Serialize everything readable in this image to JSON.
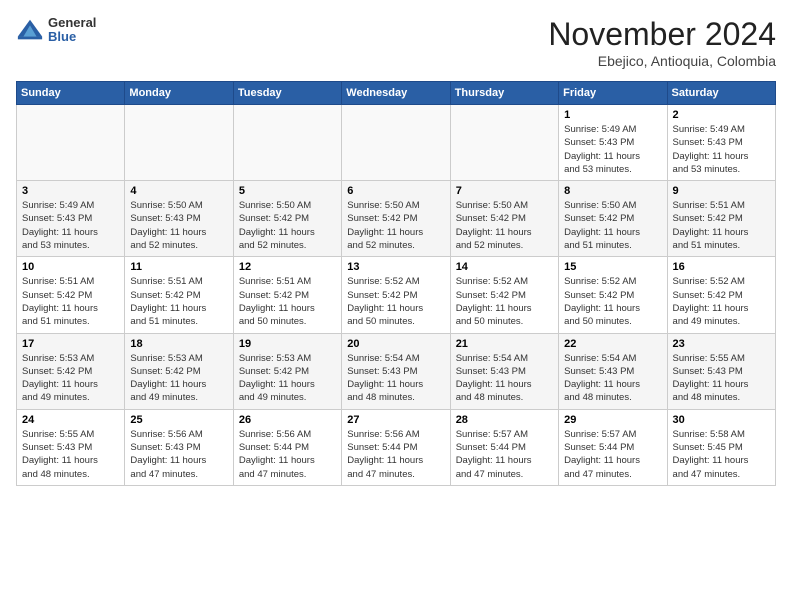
{
  "logo": {
    "text_general": "General",
    "text_blue": "Blue"
  },
  "header": {
    "month": "November 2024",
    "location": "Ebejico, Antioquia, Colombia"
  },
  "days_of_week": [
    "Sunday",
    "Monday",
    "Tuesday",
    "Wednesday",
    "Thursday",
    "Friday",
    "Saturday"
  ],
  "weeks": [
    [
      {
        "day": "",
        "info": ""
      },
      {
        "day": "",
        "info": ""
      },
      {
        "day": "",
        "info": ""
      },
      {
        "day": "",
        "info": ""
      },
      {
        "day": "",
        "info": ""
      },
      {
        "day": "1",
        "info": "Sunrise: 5:49 AM\nSunset: 5:43 PM\nDaylight: 11 hours\nand 53 minutes."
      },
      {
        "day": "2",
        "info": "Sunrise: 5:49 AM\nSunset: 5:43 PM\nDaylight: 11 hours\nand 53 minutes."
      }
    ],
    [
      {
        "day": "3",
        "info": "Sunrise: 5:49 AM\nSunset: 5:43 PM\nDaylight: 11 hours\nand 53 minutes."
      },
      {
        "day": "4",
        "info": "Sunrise: 5:50 AM\nSunset: 5:43 PM\nDaylight: 11 hours\nand 52 minutes."
      },
      {
        "day": "5",
        "info": "Sunrise: 5:50 AM\nSunset: 5:42 PM\nDaylight: 11 hours\nand 52 minutes."
      },
      {
        "day": "6",
        "info": "Sunrise: 5:50 AM\nSunset: 5:42 PM\nDaylight: 11 hours\nand 52 minutes."
      },
      {
        "day": "7",
        "info": "Sunrise: 5:50 AM\nSunset: 5:42 PM\nDaylight: 11 hours\nand 52 minutes."
      },
      {
        "day": "8",
        "info": "Sunrise: 5:50 AM\nSunset: 5:42 PM\nDaylight: 11 hours\nand 51 minutes."
      },
      {
        "day": "9",
        "info": "Sunrise: 5:51 AM\nSunset: 5:42 PM\nDaylight: 11 hours\nand 51 minutes."
      }
    ],
    [
      {
        "day": "10",
        "info": "Sunrise: 5:51 AM\nSunset: 5:42 PM\nDaylight: 11 hours\nand 51 minutes."
      },
      {
        "day": "11",
        "info": "Sunrise: 5:51 AM\nSunset: 5:42 PM\nDaylight: 11 hours\nand 51 minutes."
      },
      {
        "day": "12",
        "info": "Sunrise: 5:51 AM\nSunset: 5:42 PM\nDaylight: 11 hours\nand 50 minutes."
      },
      {
        "day": "13",
        "info": "Sunrise: 5:52 AM\nSunset: 5:42 PM\nDaylight: 11 hours\nand 50 minutes."
      },
      {
        "day": "14",
        "info": "Sunrise: 5:52 AM\nSunset: 5:42 PM\nDaylight: 11 hours\nand 50 minutes."
      },
      {
        "day": "15",
        "info": "Sunrise: 5:52 AM\nSunset: 5:42 PM\nDaylight: 11 hours\nand 50 minutes."
      },
      {
        "day": "16",
        "info": "Sunrise: 5:52 AM\nSunset: 5:42 PM\nDaylight: 11 hours\nand 49 minutes."
      }
    ],
    [
      {
        "day": "17",
        "info": "Sunrise: 5:53 AM\nSunset: 5:42 PM\nDaylight: 11 hours\nand 49 minutes."
      },
      {
        "day": "18",
        "info": "Sunrise: 5:53 AM\nSunset: 5:42 PM\nDaylight: 11 hours\nand 49 minutes."
      },
      {
        "day": "19",
        "info": "Sunrise: 5:53 AM\nSunset: 5:42 PM\nDaylight: 11 hours\nand 49 minutes."
      },
      {
        "day": "20",
        "info": "Sunrise: 5:54 AM\nSunset: 5:43 PM\nDaylight: 11 hours\nand 48 minutes."
      },
      {
        "day": "21",
        "info": "Sunrise: 5:54 AM\nSunset: 5:43 PM\nDaylight: 11 hours\nand 48 minutes."
      },
      {
        "day": "22",
        "info": "Sunrise: 5:54 AM\nSunset: 5:43 PM\nDaylight: 11 hours\nand 48 minutes."
      },
      {
        "day": "23",
        "info": "Sunrise: 5:55 AM\nSunset: 5:43 PM\nDaylight: 11 hours\nand 48 minutes."
      }
    ],
    [
      {
        "day": "24",
        "info": "Sunrise: 5:55 AM\nSunset: 5:43 PM\nDaylight: 11 hours\nand 48 minutes."
      },
      {
        "day": "25",
        "info": "Sunrise: 5:56 AM\nSunset: 5:43 PM\nDaylight: 11 hours\nand 47 minutes."
      },
      {
        "day": "26",
        "info": "Sunrise: 5:56 AM\nSunset: 5:44 PM\nDaylight: 11 hours\nand 47 minutes."
      },
      {
        "day": "27",
        "info": "Sunrise: 5:56 AM\nSunset: 5:44 PM\nDaylight: 11 hours\nand 47 minutes."
      },
      {
        "day": "28",
        "info": "Sunrise: 5:57 AM\nSunset: 5:44 PM\nDaylight: 11 hours\nand 47 minutes."
      },
      {
        "day": "29",
        "info": "Sunrise: 5:57 AM\nSunset: 5:44 PM\nDaylight: 11 hours\nand 47 minutes."
      },
      {
        "day": "30",
        "info": "Sunrise: 5:58 AM\nSunset: 5:45 PM\nDaylight: 11 hours\nand 47 minutes."
      }
    ]
  ]
}
